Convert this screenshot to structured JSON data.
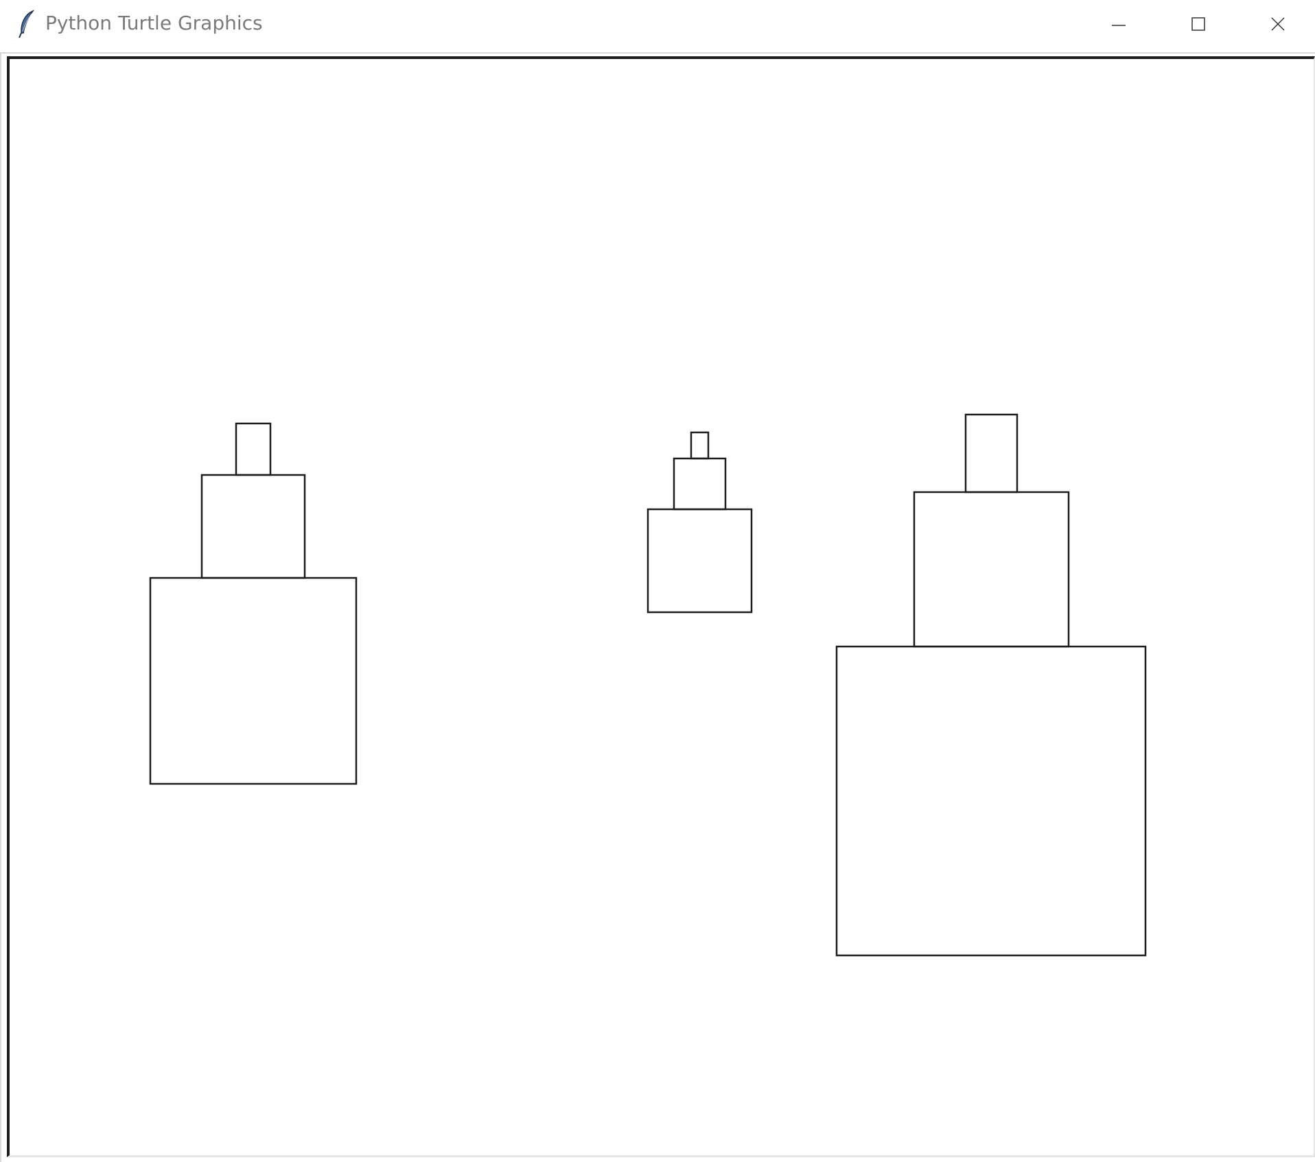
{
  "window": {
    "title": "Python Turtle Graphics",
    "icon": "feather-icon",
    "controls": {
      "minimize_icon": "minimize-icon",
      "maximize_icon": "maximize-icon",
      "close_icon": "close-icon"
    }
  },
  "canvas": {
    "background": "#ffffff",
    "stroke_color": "#1c1c1c",
    "towers": [
      {
        "name": "left-tower",
        "squares": 3
      },
      {
        "name": "middle-tower",
        "squares": 3
      },
      {
        "name": "right-tower",
        "squares": 3
      }
    ]
  }
}
